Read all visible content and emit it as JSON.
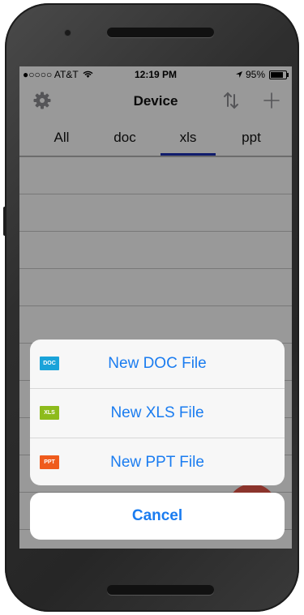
{
  "status_bar": {
    "carrier": "●○○○○ AT&T",
    "time": "12:19 PM",
    "battery_text": "95%",
    "battery_level": 0.95
  },
  "nav": {
    "title": "Device",
    "left_icon": "gear-icon",
    "right_icons": [
      "sort-icon",
      "plus-icon"
    ]
  },
  "tabs": {
    "items": [
      "All",
      "doc",
      "xls",
      "ppt"
    ],
    "selected": "xls",
    "accent": "#1c2fb5"
  },
  "action_sheet": {
    "items": [
      {
        "label": "New DOC File",
        "icon_text": "DOC",
        "icon_color": "#1aa3d9"
      },
      {
        "label": "New XLS File",
        "icon_text": "XLS",
        "icon_color": "#8dbb1c"
      },
      {
        "label": "New PPT File",
        "icon_text": "PPT",
        "icon_color": "#ef5b1c"
      }
    ],
    "cancel_label": "Cancel",
    "accent": "#1a7cf0"
  }
}
